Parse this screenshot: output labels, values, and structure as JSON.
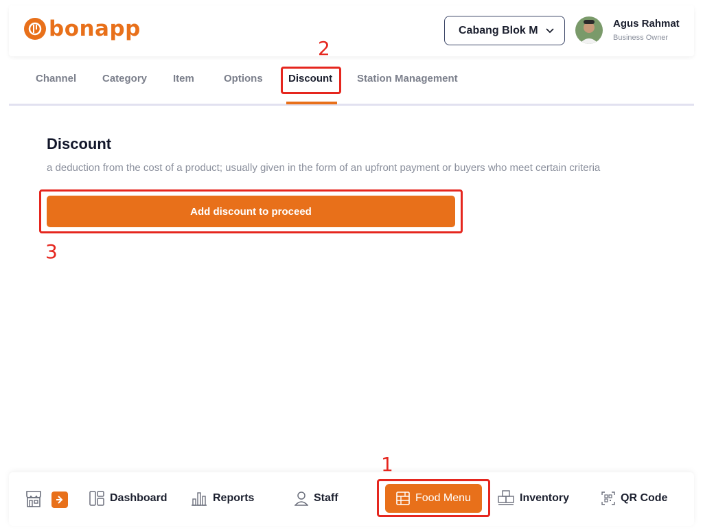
{
  "header": {
    "logo_text": "bonapp",
    "branch_label": "Cabang Blok M",
    "user_name": "Agus Rahmat",
    "user_role": "Business Owner"
  },
  "tabs": [
    {
      "label": "Channel"
    },
    {
      "label": "Category"
    },
    {
      "label": "Item"
    },
    {
      "label": "Options"
    },
    {
      "label": "Discount"
    },
    {
      "label": "Station Management"
    }
  ],
  "active_tab": "Discount",
  "content": {
    "title": "Discount",
    "description": "a deduction from the cost of a product; usually given in the form of an upfront payment or buyers who meet certain criteria",
    "primary_button": "Add discount to proceed"
  },
  "bottom_nav": [
    {
      "label": "Dashboard",
      "icon": "dashboard-icon"
    },
    {
      "label": "Reports",
      "icon": "bar-chart-icon"
    },
    {
      "label": "Staff",
      "icon": "user-icon"
    },
    {
      "label": "Food Menu",
      "icon": "menu-icon"
    },
    {
      "label": "Inventory",
      "icon": "boxes-icon"
    },
    {
      "label": "QR Code",
      "icon": "qr-code-icon"
    }
  ],
  "annotations": {
    "marker_1": "1",
    "marker_2": "2",
    "marker_3": "3"
  },
  "colors": {
    "accent": "#E8701A",
    "highlight": "#E5261E",
    "text_dark": "#1b1f2e",
    "text_muted": "#8a8f9c"
  }
}
